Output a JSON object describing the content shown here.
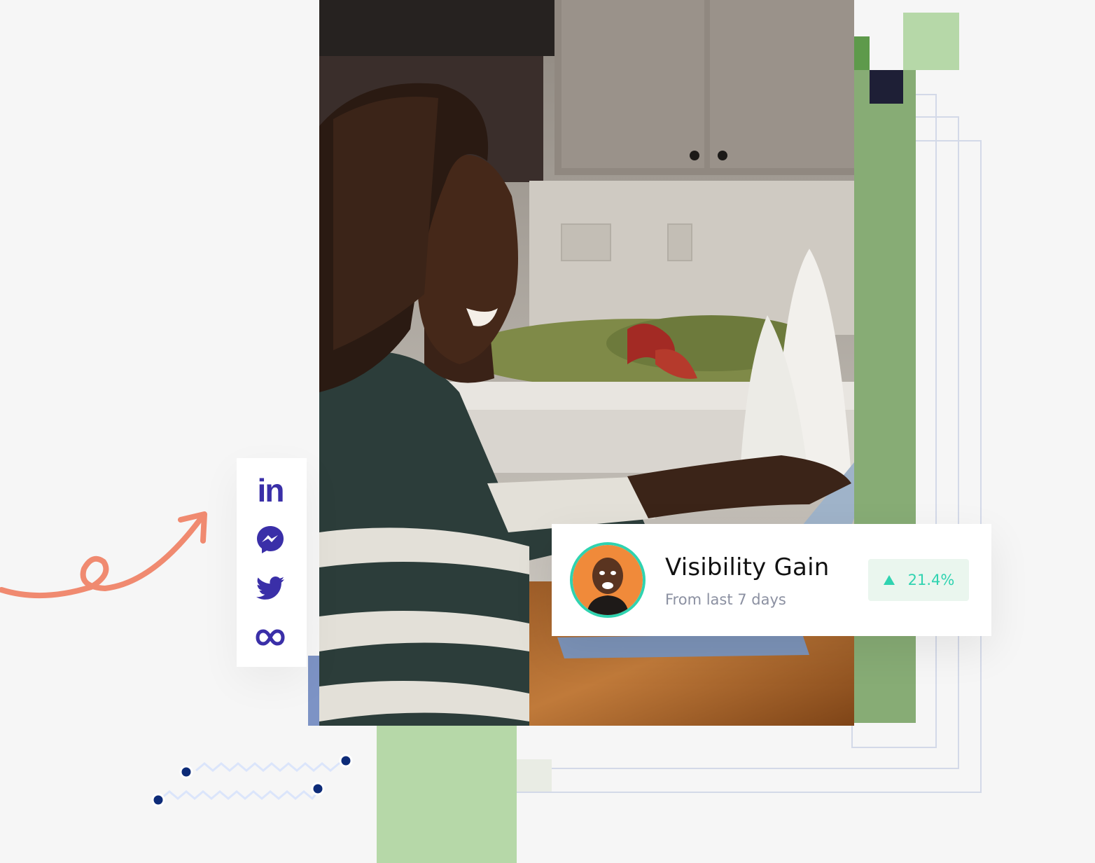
{
  "social": {
    "items": [
      {
        "name": "linkedin",
        "icon": "linkedin-icon",
        "label": "in"
      },
      {
        "name": "messenger",
        "icon": "messenger-icon"
      },
      {
        "name": "twitter",
        "icon": "twitter-icon"
      },
      {
        "name": "meta",
        "icon": "infinity-icon"
      }
    ],
    "icon_color": "#3a2fa8"
  },
  "stats_card": {
    "title": "Visibility Gain",
    "subtitle": "From last 7 days",
    "trend_icon": "triangle-up-icon",
    "change": "21.4%",
    "accent": "#2fd3b0"
  },
  "colors": {
    "background": "#f6f6f6",
    "green_dark": "#87ac75",
    "green_light": "#b6d8a8",
    "navy": "#1e1f36",
    "arrow": "#f08a70",
    "dots": "#0d2b78"
  }
}
